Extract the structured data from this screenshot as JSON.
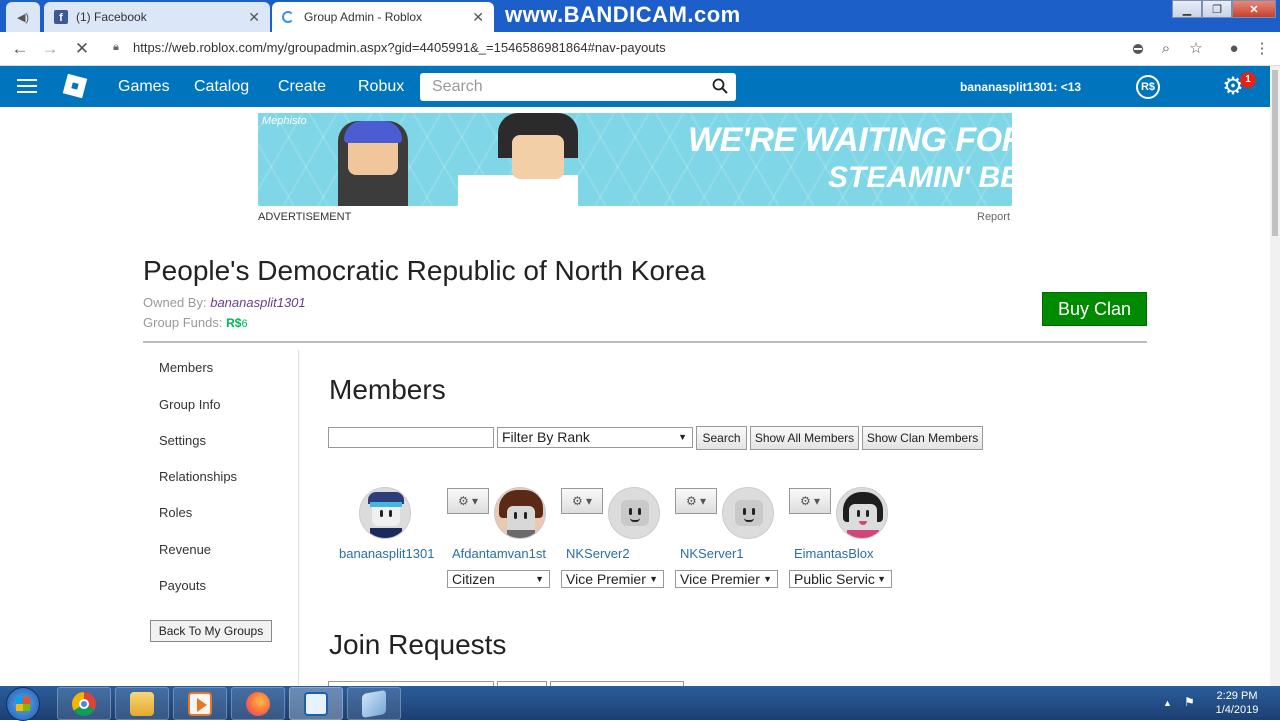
{
  "browser": {
    "tabs": [
      {
        "title": "(1) Facebook"
      },
      {
        "title": "Group Admin - Roblox"
      }
    ],
    "watermark": "www.BANDICAM.com",
    "url": "https://web.roblox.com/my/groupadmin.aspx?gid=4405991&_=1546586981864#nav-payouts"
  },
  "nav": {
    "links": [
      "Games",
      "Catalog",
      "Create",
      "Robux"
    ],
    "search_placeholder": "Search",
    "username": "bananasplit1301: <13",
    "robux_label": "R$",
    "notification_count": "1"
  },
  "ad": {
    "brand": "Mephisto",
    "headline": "WE'RE WAITING FOR YOU!",
    "subline": "STEAMIN' BEANS",
    "label": "ADVERTISEMENT",
    "report": "Report"
  },
  "group": {
    "name": "People's Democratic Republic of North Korea",
    "owned_by_label": "Owned By:",
    "owner": "bananasplit1301",
    "funds_label": "Group Funds:",
    "funds_currency": "R$",
    "funds_amount": "6",
    "buy_clan": "Buy Clan"
  },
  "menu": {
    "items": [
      "Members",
      "Group Info",
      "Settings",
      "Relationships",
      "Roles",
      "Revenue",
      "Payouts"
    ],
    "back_button": "Back To My Groups"
  },
  "members": {
    "title": "Members",
    "filter_placeholder": "",
    "filter_rank": "Filter By Rank",
    "search_button": "Search",
    "show_all": "Show All Members",
    "show_clan": "Show Clan Members",
    "list": [
      {
        "name": "bananasplit1301",
        "rank": ""
      },
      {
        "name": "Afdantamvan1st",
        "rank": "Citizen"
      },
      {
        "name": "NKServer2",
        "rank": "Vice Premier"
      },
      {
        "name": "NKServer1",
        "rank": "Vice Premier"
      },
      {
        "name": "EimantasBlox",
        "rank": "Public Servic"
      }
    ]
  },
  "join_requests": {
    "title": "Join Requests"
  },
  "taskbar": {
    "time": "2:29 PM",
    "date": "1/4/2019"
  }
}
